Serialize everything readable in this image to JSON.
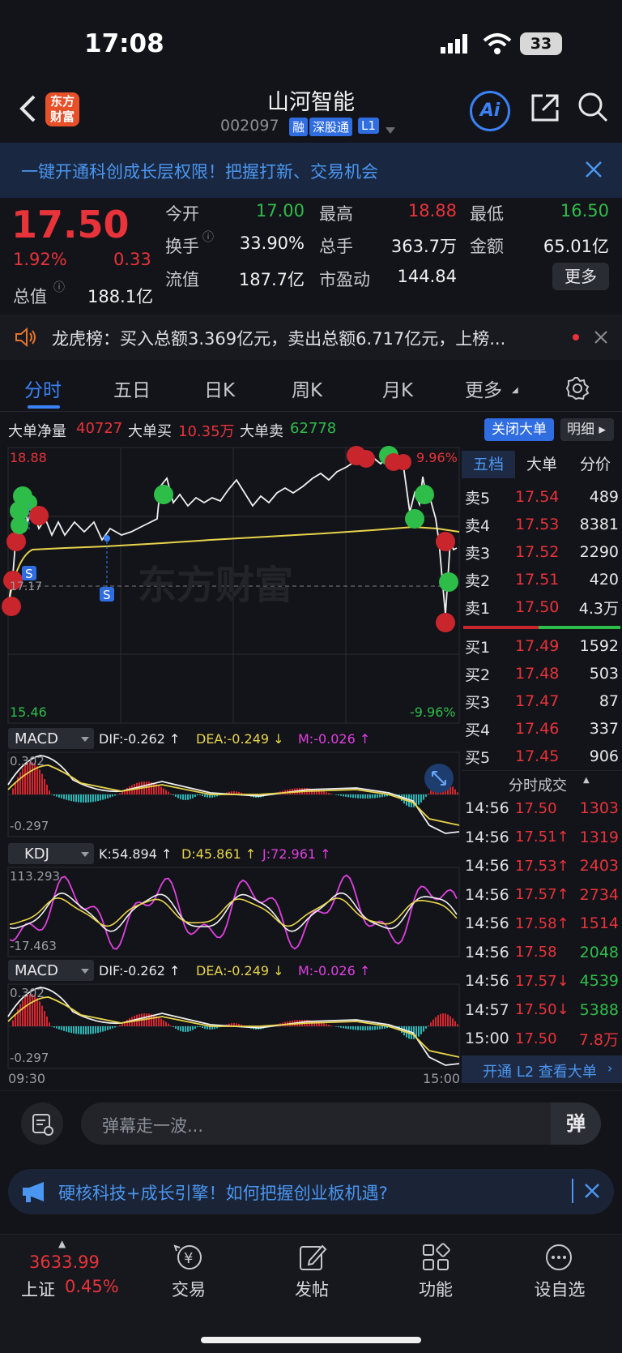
{
  "status_bar": {
    "time": "17:08",
    "battery": "33"
  },
  "header": {
    "title": "山河智能",
    "code": "002097",
    "tags": [
      "融",
      "深股通",
      "L1"
    ],
    "logo_text": "东方财富",
    "ai_label": "Ai"
  },
  "banner": {
    "text": "一键开通科创成长层权限！把握打新、交易机会"
  },
  "quote": {
    "price": "17.50",
    "change_pct": "1.92%",
    "change": "0.33",
    "open_label": "今开",
    "open": "17.00",
    "high_label": "最高",
    "high": "18.88",
    "low_label": "最低",
    "low": "16.50",
    "turnover_label": "换手",
    "turnover": "33.90%",
    "volume_label": "总手",
    "volume": "363.7万",
    "amount_label": "金额",
    "amount": "65.01亿",
    "mktcap_label": "总值",
    "mktcap": "188.1亿",
    "float_label": "流值",
    "float": "187.7亿",
    "pe_label": "市盈动",
    "pe": "144.84",
    "more_label": "更多"
  },
  "lhb": {
    "text": "龙虎榜：买入总额3.369亿元，卖出总额6.717亿元，上榜..."
  },
  "tabs": [
    "分时",
    "五日",
    "日K",
    "周K",
    "月K",
    "更多"
  ],
  "bigorder": {
    "net_label": "大单净量",
    "net": "40727",
    "buy_label": "大单买",
    "buy": "10.35万",
    "sell_label": "大单卖",
    "sell": "62778",
    "close_btn": "关闭大单",
    "detail_btn": "明细"
  },
  "intraday": {
    "max_price": "18.88",
    "min_price": "15.46",
    "max_pct": "9.96%",
    "min_pct": "-9.96%",
    "ref_price": "17.17",
    "s_marker": "S",
    "watermark": "东方财富",
    "time_start": "09:30",
    "time_end": "15:00"
  },
  "macd1": {
    "name": "MACD",
    "dif": "DIF:-0.262 ↑",
    "dea": "DEA:-0.249 ↓",
    "m": "M:-0.026 ↑",
    "top": "0.302",
    "bottom": "-0.297"
  },
  "kdj": {
    "name": "KDJ",
    "k": "K:54.894 ↑",
    "d": "D:45.861 ↑",
    "j": "J:72.961 ↑",
    "top": "113.293",
    "bottom": "-17.463"
  },
  "macd2": {
    "name": "MACD",
    "dif": "DIF:-0.262 ↑",
    "dea": "DEA:-0.249 ↓",
    "m": "M:-0.026 ↑",
    "top": "0.302",
    "bottom": "-0.297"
  },
  "book_tabs": [
    "五档",
    "大单",
    "分价"
  ],
  "asks": [
    {
      "label": "卖5",
      "price": "17.54",
      "vol": "489"
    },
    {
      "label": "卖4",
      "price": "17.53",
      "vol": "8381"
    },
    {
      "label": "卖3",
      "price": "17.52",
      "vol": "2290"
    },
    {
      "label": "卖2",
      "price": "17.51",
      "vol": "420"
    },
    {
      "label": "卖1",
      "price": "17.50",
      "vol": "4.3万"
    }
  ],
  "bids": [
    {
      "label": "买1",
      "price": "17.49",
      "vol": "1592"
    },
    {
      "label": "买2",
      "price": "17.48",
      "vol": "503"
    },
    {
      "label": "买3",
      "price": "17.47",
      "vol": "87"
    },
    {
      "label": "买4",
      "price": "17.46",
      "vol": "337"
    },
    {
      "label": "买5",
      "price": "17.45",
      "vol": "906"
    }
  ],
  "trades_title": "分时成交",
  "trades": [
    {
      "time": "14:56",
      "price": "17.50",
      "vol": "1303",
      "dir": "",
      "color": "red"
    },
    {
      "time": "14:56",
      "price": "17.51",
      "vol": "1319",
      "dir": "↑",
      "color": "red"
    },
    {
      "time": "14:56",
      "price": "17.53",
      "vol": "2403",
      "dir": "↑",
      "color": "red"
    },
    {
      "time": "14:56",
      "price": "17.57",
      "vol": "2734",
      "dir": "↑",
      "color": "red"
    },
    {
      "time": "14:56",
      "price": "17.58",
      "vol": "1514",
      "dir": "↑",
      "color": "red"
    },
    {
      "time": "14:56",
      "price": "17.58",
      "vol": "2048",
      "dir": "",
      "color": "green"
    },
    {
      "time": "14:56",
      "price": "17.57",
      "vol": "4539",
      "dir": "↓",
      "color": "green"
    },
    {
      "time": "14:57",
      "price": "17.50",
      "vol": "5388",
      "dir": "↓",
      "color": "green"
    },
    {
      "time": "15:00",
      "price": "17.50",
      "vol": "7.8万",
      "dir": "",
      "color": "red"
    }
  ],
  "l2_btn": "开通 L2 查看大单",
  "barrage": {
    "placeholder": "弹幕走一波...",
    "send": "弹"
  },
  "ad": {
    "text": "硬核科技+成长引擎！如何把握创业板机遇?"
  },
  "nav": {
    "index_value": "3633.99",
    "index_name": "上证",
    "index_pct": "0.45%",
    "items": [
      "交易",
      "发帖",
      "功能",
      "设自选"
    ]
  },
  "colors": {
    "up": "#e8333a",
    "down": "#2fbd4a",
    "accent": "#2f7cf6"
  }
}
